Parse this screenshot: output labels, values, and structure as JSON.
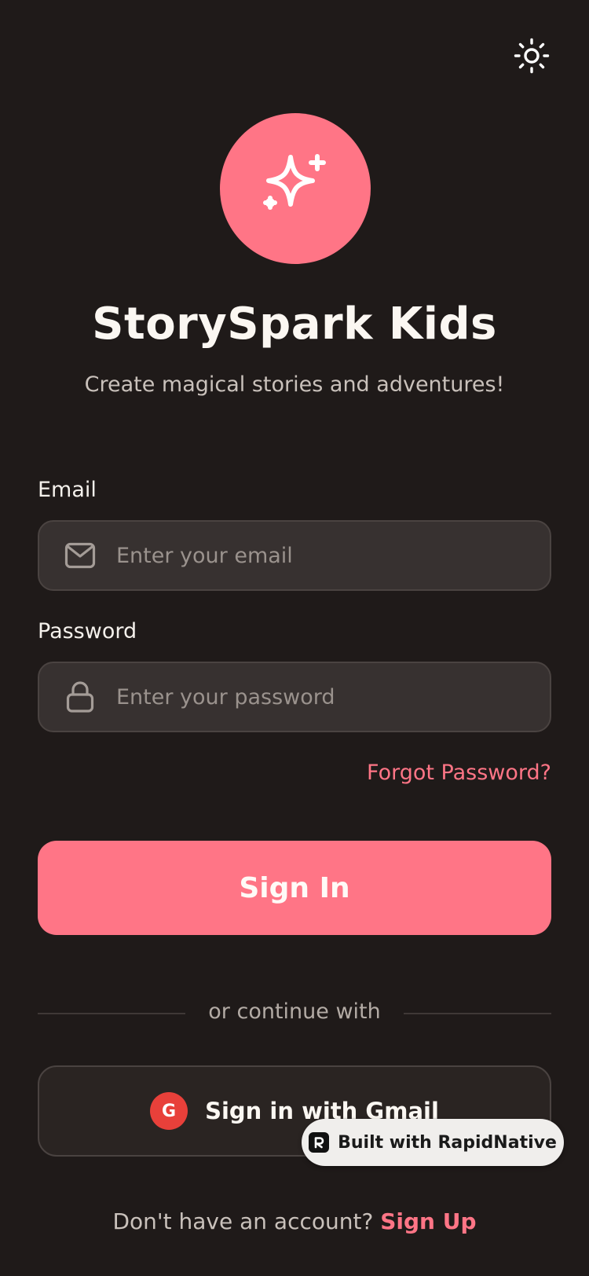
{
  "header": {
    "theme_toggle_icon": "sun-icon"
  },
  "brand": {
    "logo_icon": "sparkles-icon",
    "title": "StorySpark Kids",
    "subtitle": "Create magical stories and adventures!"
  },
  "form": {
    "email": {
      "label": "Email",
      "placeholder": "Enter your email",
      "value": "",
      "icon": "mail-icon"
    },
    "password": {
      "label": "Password",
      "placeholder": "Enter your password",
      "value": "",
      "icon": "lock-icon"
    },
    "forgot_label": "Forgot Password?",
    "submit_label": "Sign In"
  },
  "divider": {
    "label": "or continue with"
  },
  "social": {
    "gmail_badge": "G",
    "gmail_label": "Sign in with Gmail"
  },
  "footer": {
    "prompt": "Don't have an account?",
    "signup_label": "Sign Up"
  },
  "watermark": {
    "label": "Built with RapidNative"
  },
  "colors": {
    "background": "#1f1a19",
    "accent": "#ff7586",
    "field_bg": "#373130",
    "google_red": "#e8403a"
  }
}
